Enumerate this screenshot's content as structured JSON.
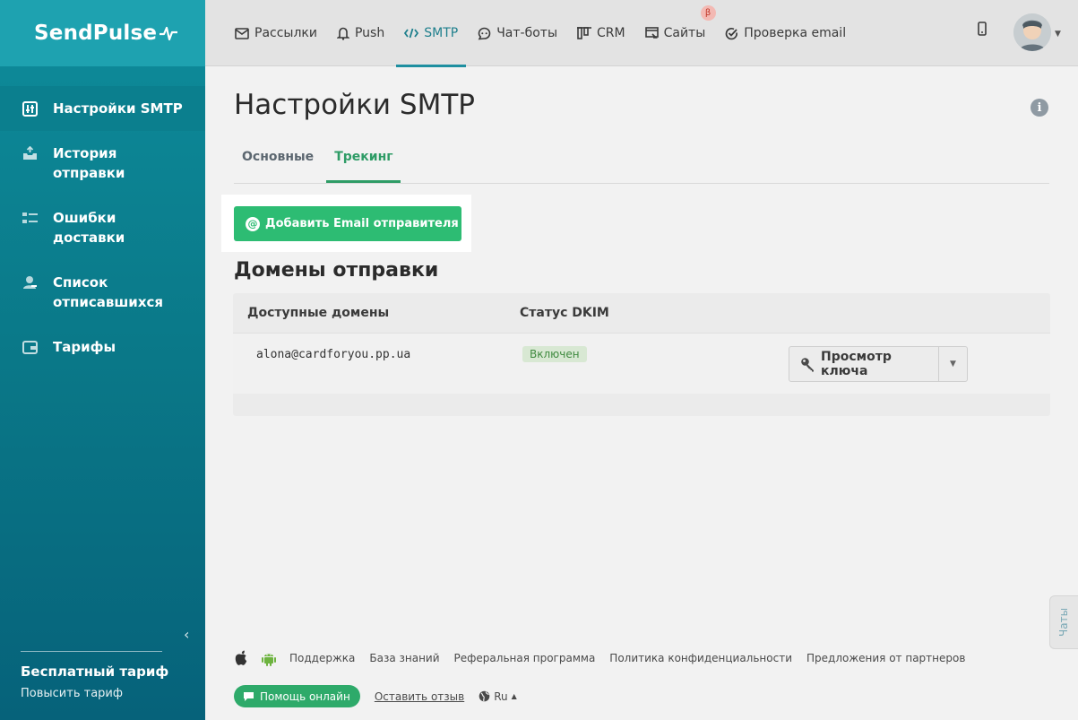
{
  "brand": {
    "logo": "SendPulse"
  },
  "sidebar": {
    "items": [
      {
        "label": "Настройки SMTP",
        "icon": "settings-sliders-icon",
        "active": true
      },
      {
        "label": "История отправки",
        "icon": "outbox-tray-icon",
        "active": false
      },
      {
        "label": "Ошибки доставки",
        "icon": "bounce-list-icon",
        "active": false
      },
      {
        "label": "Список отписавшихся",
        "icon": "user-minus-icon",
        "active": false
      },
      {
        "label": "Тарифы",
        "icon": "wallet-icon",
        "active": false
      }
    ],
    "plan_name": "Бесплатный тариф",
    "plan_upgrade": "Повысить тариф"
  },
  "topnav": {
    "items": [
      {
        "label": "Рассылки",
        "icon": "envelope-icon",
        "active": false
      },
      {
        "label": "Push",
        "icon": "bell-icon",
        "active": false
      },
      {
        "label": "SMTP",
        "icon": "code-icon",
        "active": true
      },
      {
        "label": "Чат-боты",
        "icon": "chat-bot-icon",
        "active": false
      },
      {
        "label": "CRM",
        "icon": "crm-icon",
        "active": false
      },
      {
        "label": "Сайты",
        "icon": "site-icon",
        "active": false,
        "badge": "β"
      },
      {
        "label": "Проверка email",
        "icon": "check-circle-icon",
        "active": false
      }
    ]
  },
  "page": {
    "title": "Настройки SMTP",
    "tabs": [
      {
        "label": "Основные",
        "active": false
      },
      {
        "label": "Трекинг",
        "active": true
      }
    ],
    "add_button": "Добавить Email отправителя",
    "section_title": "Домены отправки",
    "table": {
      "headers": [
        "Доступные домены",
        "Статус DKIM"
      ],
      "rows": [
        {
          "domain": "alona@cardforyou.pp.ua",
          "status": "Включен",
          "action": "Просмотр ключа"
        }
      ]
    }
  },
  "footer": {
    "links": [
      "Поддержка",
      "База знаний",
      "Реферальная программа",
      "Политика конфиденциальности",
      "Предложения от партнеров"
    ],
    "help": "Помощь онлайн",
    "feedback": "Оставить отзыв",
    "lang": "Ru"
  },
  "chats_tab": "Чаты",
  "colors": {
    "accent_green": "#2dbc73",
    "sidebar": "#0a7888",
    "active_tab": "#2e9c66"
  }
}
